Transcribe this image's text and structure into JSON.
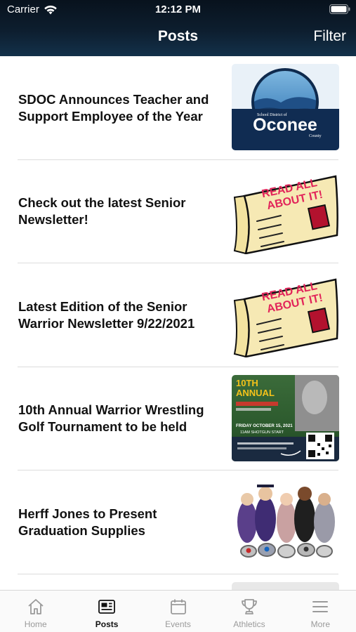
{
  "status_bar": {
    "carrier": "Carrier",
    "time": "12:12 PM"
  },
  "header": {
    "title": "Posts",
    "filter_label": "Filter"
  },
  "posts": [
    {
      "title": "SDOC Announces Teacher and Support Employee of the Year",
      "thumbnail": "oconee-logo",
      "logo_small_text": "School District of",
      "logo_text": "Oconee",
      "logo_sub_text": "County"
    },
    {
      "title": "Check out the latest Senior Newsletter!",
      "thumbnail": "newspaper",
      "banner_line1": "READ ALL",
      "banner_line2": "ABOUT IT!"
    },
    {
      "title": "Latest Edition of the Senior Warrior Newsletter 9/22/2021",
      "thumbnail": "newspaper",
      "banner_line1": "READ ALL",
      "banner_line2": "ABOUT IT!"
    },
    {
      "title": "10th Annual Warrior Wrestling Golf Tournament to be held",
      "thumbnail": "golf-flyer",
      "flyer_line1": "10TH",
      "flyer_line2": "ANNUAL",
      "flyer_date": "FRIDAY OCTOBER 15, 2021",
      "flyer_time": "11AM SHOTGUN START"
    },
    {
      "title": "Herff Jones to Present Graduation Supplies",
      "thumbnail": "graduates-photo"
    }
  ],
  "tabs": [
    {
      "label": "Home",
      "icon": "home-icon",
      "active": false
    },
    {
      "label": "Posts",
      "icon": "newspaper-icon",
      "active": true
    },
    {
      "label": "Events",
      "icon": "calendar-icon",
      "active": false
    },
    {
      "label": "Athletics",
      "icon": "trophy-icon",
      "active": false
    },
    {
      "label": "More",
      "icon": "menu-icon",
      "active": false
    }
  ],
  "colors": {
    "header_bg": "#0d1e2f",
    "active_tab": "#111111",
    "inactive_tab": "#9a9a9a",
    "paper": "#f3e3a0",
    "banner_text": "#e2245a"
  }
}
